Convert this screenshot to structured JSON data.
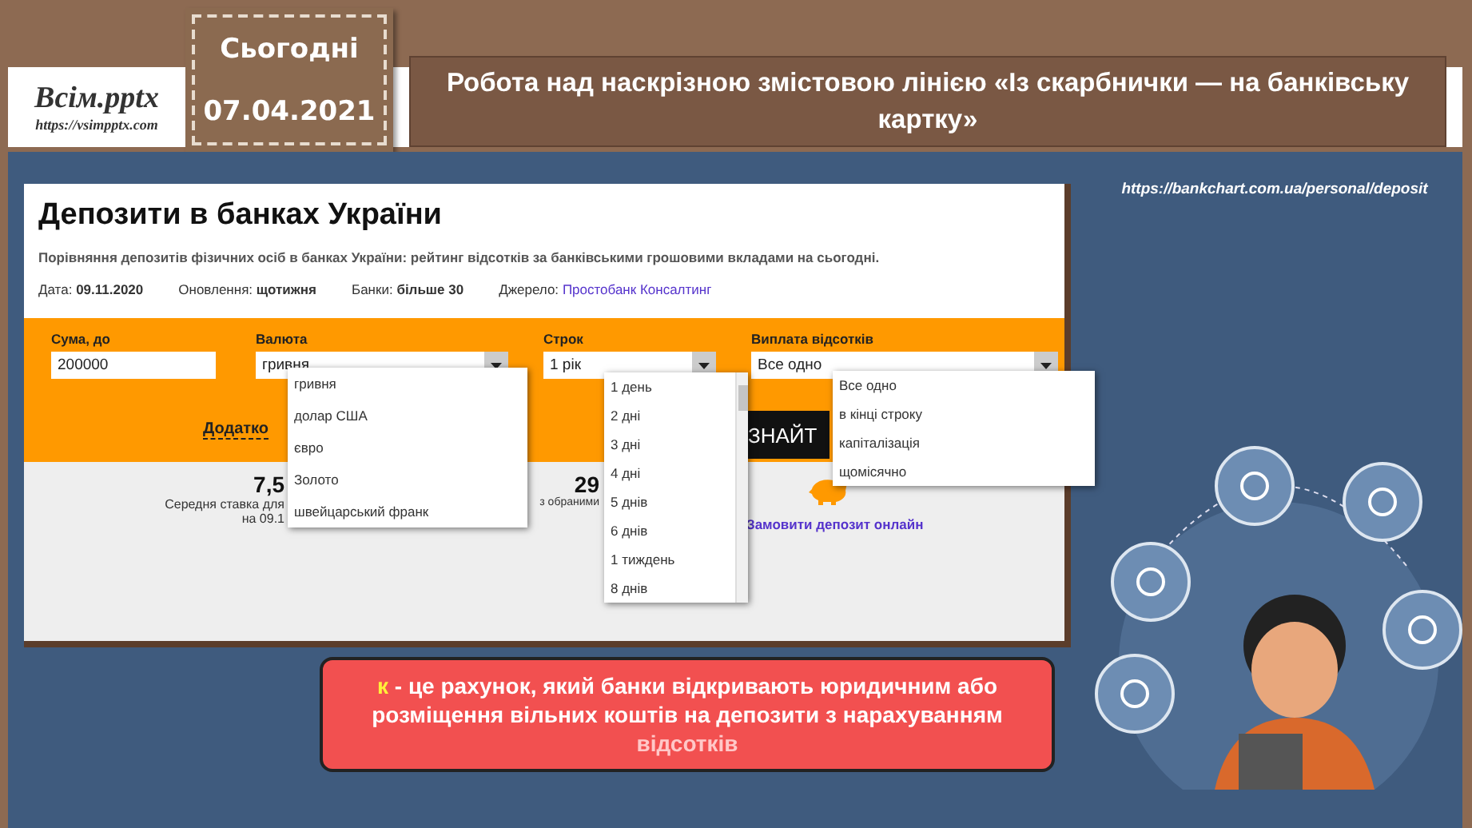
{
  "header": {
    "logo_title": "Всім.pptx",
    "logo_url": "https://vsimpptx.com",
    "date_label": "Сьогодні",
    "date": "07.04.2021",
    "title": "Робота над наскрізною змістовою лінією «Із скарбнички — на банківську картку»"
  },
  "source_url": "https://bankchart.com.ua/personal/deposit",
  "web_page": {
    "title": "Депозити в банках України",
    "subtitle": "Порівняння депозитів фізичних осіб в банках України: рейтинг відсотків за банківськими грошовими вкладами на сьогодні.",
    "meta": [
      {
        "label": "Дата:",
        "value": "09.11.2020",
        "kind": "bold"
      },
      {
        "label": "Оновлення:",
        "value": "щотижня",
        "kind": "bold"
      },
      {
        "label": "Банки:",
        "value": "більше 30",
        "kind": "bold"
      },
      {
        "label": "Джерело:",
        "value": "Простобанк Консалтинг",
        "kind": "link"
      }
    ],
    "fields": [
      {
        "label": "Сума, до",
        "value": "200000",
        "kind": "input"
      },
      {
        "label": "Валюта",
        "value": "гривня",
        "kind": "select"
      },
      {
        "label": "Строк",
        "value": "1 рік",
        "kind": "select"
      },
      {
        "label": "Виплата відсотків",
        "value": "Все одно",
        "kind": "select"
      }
    ],
    "extra_link": "Додатко",
    "search_button": "ЗНАЙТ",
    "stats": [
      {
        "value": "7,5",
        "lines": [
          "Середня ставка для",
          "на 09.1"
        ]
      },
      {
        "value": "29",
        "lines": [
          "з обраними"
        ]
      }
    ],
    "order_link": "Замовити депозит онлайн",
    "dropdowns": [
      {
        "kind": "plain",
        "options": [
          "гривня",
          "долар США",
          "євро",
          "Золото",
          "швейцарський франк"
        ]
      },
      {
        "kind": "scrolling",
        "options": [
          "1 день",
          "2 дні",
          "3 дні",
          "4 дні",
          "5 днів",
          "6 днів",
          "1 тиждень",
          "8 днів"
        ]
      },
      {
        "kind": "plain",
        "options": [
          "Все одно",
          "в кінці строку",
          "капіталізація",
          "щомісячно"
        ]
      }
    ]
  },
  "definition": {
    "term": "к",
    "lines": [
      "- це рахунок, який банки відкривають юридичним або",
      "розміщення вільних коштів на депозити з нарахуванням",
      "відсотків"
    ]
  }
}
